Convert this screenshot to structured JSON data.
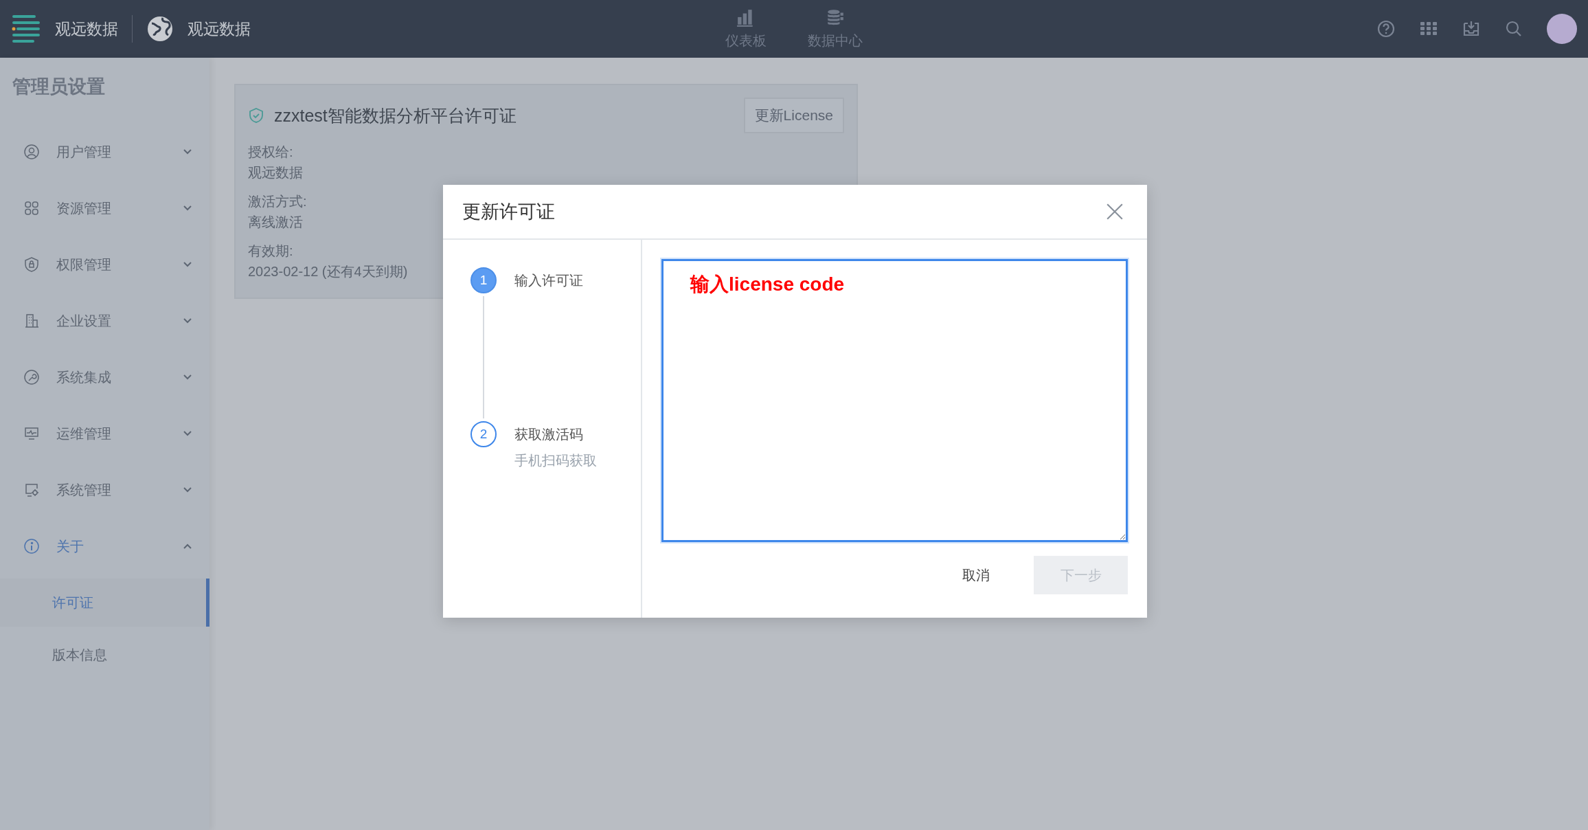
{
  "topbar": {
    "brand": "观远数据",
    "org": "观远数据",
    "nav": [
      {
        "label": "仪表板"
      },
      {
        "label": "数据中心"
      }
    ]
  },
  "sidebar": {
    "title": "管理员设置",
    "items": [
      {
        "label": "用户管理",
        "expanded": false
      },
      {
        "label": "资源管理",
        "expanded": false
      },
      {
        "label": "权限管理",
        "expanded": false
      },
      {
        "label": "企业设置",
        "expanded": false
      },
      {
        "label": "系统集成",
        "expanded": false
      },
      {
        "label": "运维管理",
        "expanded": false
      },
      {
        "label": "系统管理",
        "expanded": false
      },
      {
        "label": "关于",
        "expanded": true,
        "children": [
          {
            "label": "许可证",
            "selected": true
          },
          {
            "label": "版本信息",
            "selected": false
          }
        ]
      }
    ]
  },
  "license_card": {
    "title": "zzxtest智能数据分析平台许可证",
    "button": "更新License",
    "fields": [
      {
        "label": "授权给:",
        "value": "观远数据"
      },
      {
        "label": "激活方式:",
        "value": "离线激活"
      },
      {
        "label": "有效期:",
        "value": "2023-02-12 (还有4天到期)"
      }
    ]
  },
  "dialog": {
    "title": "更新许可证",
    "steps": [
      {
        "number": "1",
        "label": "输入许可证",
        "active": true
      },
      {
        "number": "2",
        "label": "获取激活码",
        "sublabel": "手机扫码获取",
        "active": false
      }
    ],
    "annotation": "输入license code",
    "cancel": "取消",
    "next": {
      "label": "下一步",
      "disabled": true
    }
  }
}
